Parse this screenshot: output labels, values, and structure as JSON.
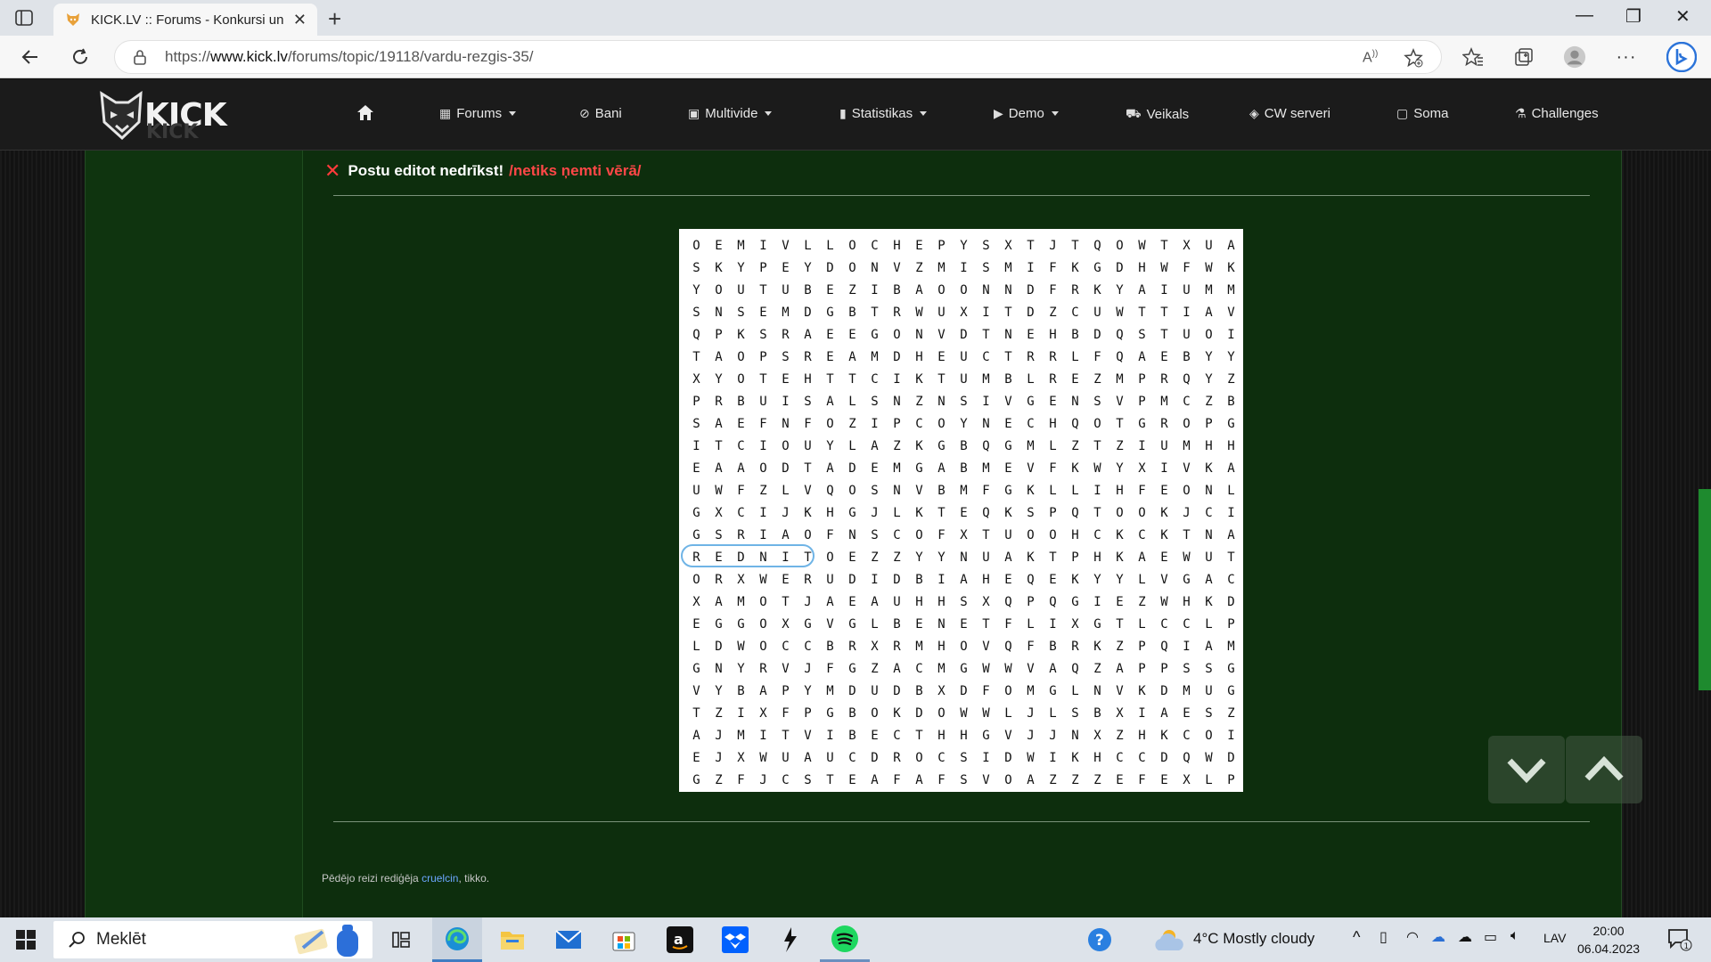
{
  "browser": {
    "tab_title": "KICK.LV :: Forums - Konkursi un p",
    "url_host": "www.kick.lv",
    "url_prefix": "https://",
    "url_path": "/forums/topic/19118/vardu-rezgis-35/"
  },
  "nav": {
    "items": [
      {
        "label": "Forums",
        "icon": "grid-icon",
        "dropdown": true
      },
      {
        "label": "Bani",
        "icon": "ban-icon",
        "dropdown": false
      },
      {
        "label": "Multivide",
        "icon": "image-icon",
        "dropdown": true
      },
      {
        "label": "Statistikas",
        "icon": "bar-chart-icon",
        "dropdown": true
      },
      {
        "label": "Demo",
        "icon": "video-icon",
        "dropdown": true
      },
      {
        "label": "Veikals",
        "icon": "cart-icon",
        "dropdown": false
      },
      {
        "label": "CW serveri",
        "icon": "gamepad-icon",
        "dropdown": false
      },
      {
        "label": "Soma",
        "icon": "bag-icon",
        "dropdown": false
      },
      {
        "label": "Challenges",
        "icon": "flask-icon",
        "dropdown": false
      }
    ]
  },
  "post": {
    "notice_main": "Postu editot nedrīkst!",
    "notice_red": "/netiks ņemti vērā/",
    "edit_prefix": "Pēdējo reizi rediģēja",
    "edit_user": "cruelcin",
    "edit_suffix": ", tikko."
  },
  "puzzle": {
    "rows": [
      "OEMIVLLOCHEPYSXTJTQOWTXUA",
      "SKYPEYDONVZMISMIFKGDHWFWK",
      "YOUTUBEZIBAOONNDFRKYAIUMM",
      "SNSEMDGBTRWUXITDZCUWTTIAV",
      "QPKSRAEEGONVDTNEHBDQSTUOI",
      "TAOPSREAMDHEUCTRRLFQAEBYY",
      "XYOTEHTTCIKTUMBLREZMPRQYZ",
      "PRBUISALSNZNSIVGENSVPMCZB",
      "SAEFNFOZIPCOYNECHQOTGROPG",
      "ITCIOUYLAZKGBQGMLZTZIUMHH",
      "EAAODTADEMGABMEVFKWYXIVKA",
      "UWFZLVQOSNVBMFGKLLIHFEONL",
      "GXCIJKHGJLKTEQKSPQTOOKJCI",
      "GSRIAOFNSCOFXTUOOHCKCKTNA",
      "REDNITOEZZYYNUAKTPHKAEWUT",
      "ORXWERUDIDBIAHEQEKYYLVGAC",
      "XAMOTJAEAUHHSXQPQGIEZWHKD",
      "EGGOXGVGLBENETFLIXGTLCCLP",
      "LDWOCCBRXRMHOVQFBRKZPQIAM",
      "GNYRVJFGZACMGWWVAQZAPPSSG",
      "VYBAPYMDUDBXDFOMGLNVKDMUG",
      "TZIXFPGBOKDOWWLJLSBXIAESZ",
      "AJMITVIBECTHHGVJJNXZHKCOI",
      "EJXWUAUCDROCSIDWIKHCCDQWD",
      "GZFJCSTEAFAFSVOAZZZEFEXLP"
    ],
    "highlight_word": "REDNIT"
  },
  "taskbar": {
    "search_placeholder": "Meklēt",
    "weather": "4°C  Mostly cloudy",
    "lang": "LAV",
    "time": "20:00",
    "date": "06.04.2023"
  },
  "colors": {
    "content_bg": "#0d2e0d",
    "notice_red": "#ff4747",
    "highlight": "#6fb4e6"
  }
}
